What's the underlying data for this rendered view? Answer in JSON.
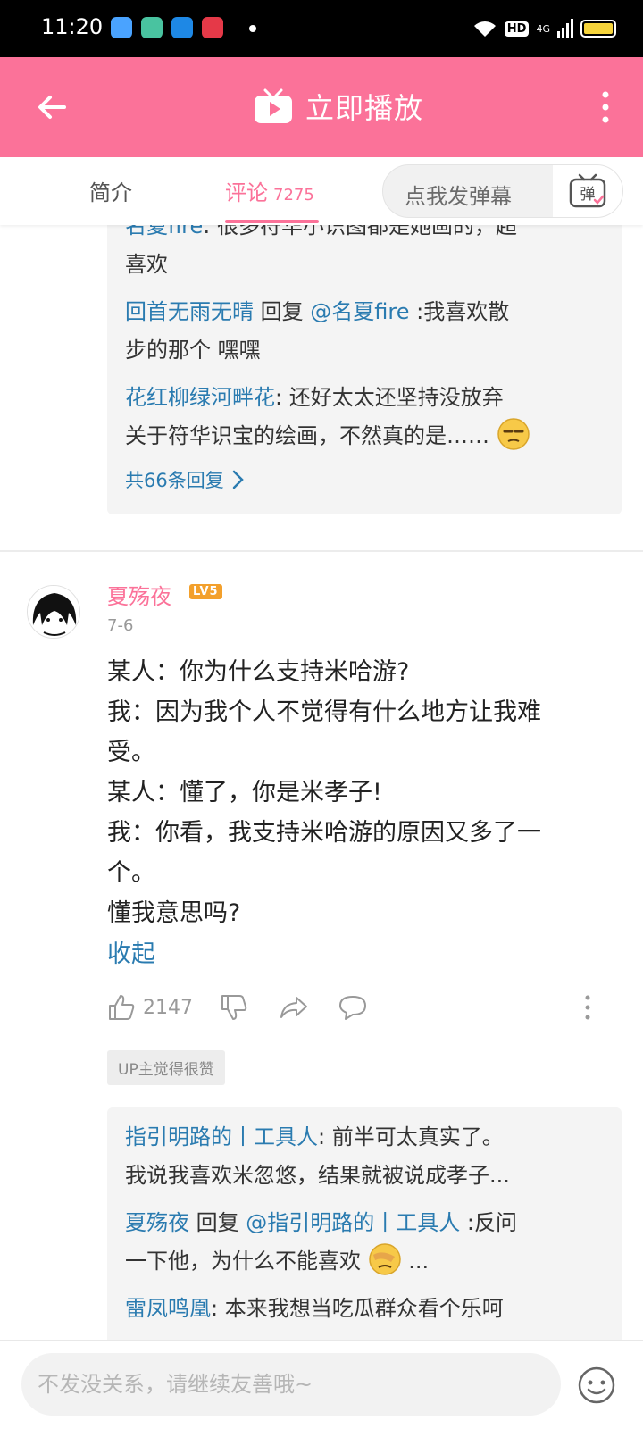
{
  "status_bar": {
    "time": "11:20",
    "hd": "HD",
    "network": "4G"
  },
  "header": {
    "title": "立即播放"
  },
  "tabs": {
    "intro": "简介",
    "comments": "评论",
    "comments_count": "7275",
    "danmaku_placeholder": "点我发弹幕",
    "danmaku_icon_label": "弹"
  },
  "top_replies": {
    "lines": [
      {
        "user": "名夏fire",
        "text": ": 很多符华小识图都是她画的，超"
      },
      {
        "text": "喜欢"
      },
      {
        "user": "回首无雨无晴",
        "mid": " 回复 ",
        "at": "@名夏fire",
        "text": " :我喜欢散"
      },
      {
        "text": "步的那个 嘿嘿"
      },
      {
        "user": "花红柳绿河畔花",
        "text": ": 还好太太还坚持没放弃"
      },
      {
        "text": "关于符华识宝的绘画，不然真的是……"
      }
    ],
    "see_more": "共66条回复"
  },
  "comment": {
    "username": "夏殇夜",
    "level": "LV5",
    "date": "7-6",
    "body_lines": [
      "某人：你为什么支持米哈游?",
      "我：因为我个人不觉得有什么地方让我难",
      "受。",
      "某人：懂了，你是米孝子!",
      "我：你看，我支持米哈游的原因又多了一",
      "个。",
      "懂我意思吗?"
    ],
    "collapse": "收起",
    "likes": "2147",
    "up_badge": "UP主觉得很赞"
  },
  "sub_replies": {
    "lines": [
      {
        "user": "指引明路的丨工具人",
        "text": ": 前半可太真实了。"
      },
      {
        "text": "我说我喜欢米忽悠，结果就被说成孝子..."
      },
      {
        "user": "夏殇夜",
        "mid": " 回复 ",
        "at": "@指引明路的丨工具人",
        "text": " :反问"
      },
      {
        "text": "一下他，为什么不能喜欢",
        "tail": " ..."
      },
      {
        "user": "雷凤鸣凰",
        "text": ": 本来我想当吃瓜群众看个乐呵"
      }
    ]
  },
  "bottom": {
    "placeholder": "不发没关系，请继续友善哦~"
  },
  "colors": {
    "brand_pink": "#fb7299",
    "link_blue": "#2a7bb0"
  }
}
